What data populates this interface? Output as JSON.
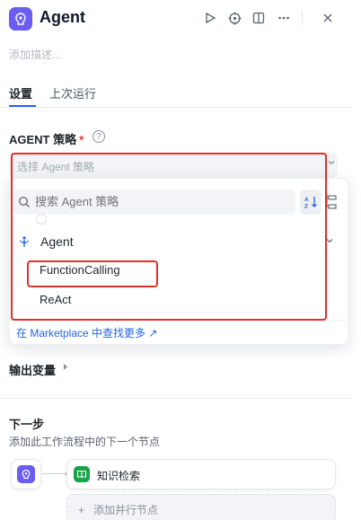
{
  "header": {
    "title": "Agent",
    "description_placeholder": "添加描述...",
    "buttons": [
      "run-icon",
      "locate-icon",
      "split-view-icon",
      "more-icon",
      "close-icon"
    ]
  },
  "tabs": [
    {
      "label": "设置",
      "active": true
    },
    {
      "label": "上次运行",
      "active": false
    }
  ],
  "strategy": {
    "label": "AGENT 策略",
    "required_mark": "*",
    "select_placeholder": "选择 Agent 策略",
    "dropdown": {
      "search_placeholder": "搜索 Agent 策略",
      "provider": "Agent",
      "options": [
        "FunctionCalling",
        "ReAct"
      ],
      "marketplace_link": "在 Marketplace 中查找更多",
      "marketplace_arrow": "↗"
    }
  },
  "output": {
    "label": "输出变量"
  },
  "next_step": {
    "title": "下一步",
    "description": "添加此工作流程中的下一个节点",
    "next_node_label": "知识检索",
    "add_parallel_label": "添加并行节点",
    "add_symbol": "+"
  },
  "colors": {
    "accent": "#2563eb",
    "agent_node": "#6b5cf2",
    "knowledge_node": "#16a34a",
    "annotation": "#e0302b"
  }
}
